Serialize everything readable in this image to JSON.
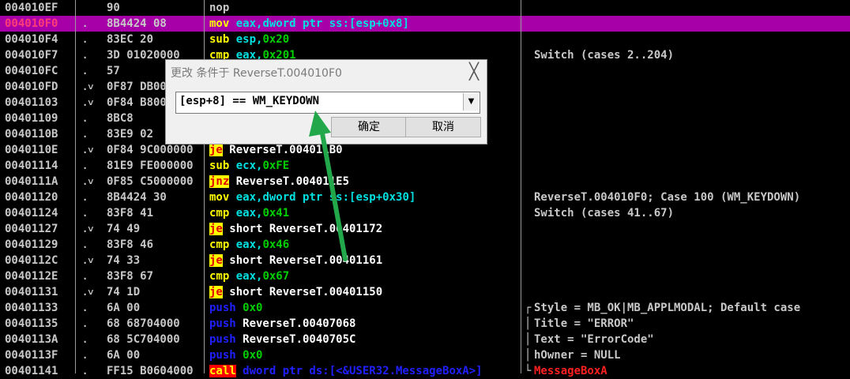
{
  "rows": [
    {
      "addr": "004010EF",
      "mark": "",
      "hex": "90",
      "selected": false,
      "asm": [
        [
          "nop",
          "t-gray"
        ]
      ],
      "cmt": ""
    },
    {
      "addr": "004010F0",
      "mark": ".",
      "hex": "8B4424 08",
      "selected": true,
      "asm": [
        [
          "mov",
          "m-yellow2"
        ],
        [
          " eax,dword ptr ss:[esp+0x8]",
          "t-cyan"
        ]
      ],
      "cmt": ""
    },
    {
      "addr": "004010F4",
      "mark": ".",
      "hex": "83EC 20",
      "selected": false,
      "asm": [
        [
          "sub",
          "m-yellow2"
        ],
        [
          " esp,",
          "t-cyan"
        ],
        [
          "0x20",
          "t-green"
        ]
      ],
      "cmt": ""
    },
    {
      "addr": "004010F7",
      "mark": ".",
      "hex": "3D 01020000",
      "selected": false,
      "asm": [
        [
          "cmp",
          "m-yellow2"
        ],
        [
          " eax,",
          "t-cyan"
        ],
        [
          "0x201",
          "t-green"
        ]
      ],
      "cmt": "Switch (cases 2..204)"
    },
    {
      "addr": "004010FC",
      "mark": ".",
      "hex": "57",
      "selected": false,
      "asm": [],
      "cmt": ""
    },
    {
      "addr": "004010FD",
      "mark": ".˅",
      "hex": "0F87 DB000000",
      "selected": false,
      "asm": [],
      "cmt": ""
    },
    {
      "addr": "00401103",
      "mark": ".˅",
      "hex": "0F84 B8000000",
      "selected": false,
      "asm": [],
      "cmt": ""
    },
    {
      "addr": "00401109",
      "mark": ".",
      "hex": "8BC8",
      "selected": false,
      "asm": [],
      "cmt": ""
    },
    {
      "addr": "0040110B",
      "mark": ".",
      "hex": "83E9 02",
      "selected": false,
      "asm": [],
      "cmt": ""
    },
    {
      "addr": "0040110E",
      "mark": ".˅",
      "hex": "0F84 9C000000",
      "selected": false,
      "asm": [
        [
          "je",
          "m-yellow"
        ],
        [
          " ReverseT.004011B0",
          "t-white"
        ]
      ],
      "cmt": ""
    },
    {
      "addr": "00401114",
      "mark": ".",
      "hex": "81E9 FE000000",
      "selected": false,
      "asm": [
        [
          "sub",
          "m-yellow2"
        ],
        [
          " ecx,",
          "t-cyan"
        ],
        [
          "0xFE",
          "t-green"
        ]
      ],
      "cmt": ""
    },
    {
      "addr": "0040111A",
      "mark": ".˅",
      "hex": "0F85 C5000000",
      "selected": false,
      "asm": [
        [
          "jnz",
          "m-yellow"
        ],
        [
          " ReverseT.004011E5",
          "t-white"
        ]
      ],
      "cmt": ""
    },
    {
      "addr": "00401120",
      "mark": ".",
      "hex": "8B4424 30",
      "selected": false,
      "asm": [
        [
          "mov",
          "m-yellow2"
        ],
        [
          " eax,dword ptr ss:[esp+0x30]",
          "t-cyan"
        ]
      ],
      "cmt": "ReverseT.004010F0; Case 100 (WM_KEYDOWN)"
    },
    {
      "addr": "00401124",
      "mark": ".",
      "hex": "83F8 41",
      "selected": false,
      "asm": [
        [
          "cmp",
          "m-yellow2"
        ],
        [
          " eax,",
          "t-cyan"
        ],
        [
          "0x41",
          "t-green"
        ]
      ],
      "cmt": "Switch (cases 41..67)"
    },
    {
      "addr": "00401127",
      "mark": ".˅",
      "hex": "74 49",
      "selected": false,
      "asm": [
        [
          "je",
          "m-yellow"
        ],
        [
          " short ReverseT.00401172",
          "t-white"
        ]
      ],
      "cmt": ""
    },
    {
      "addr": "00401129",
      "mark": ".",
      "hex": "83F8 46",
      "selected": false,
      "asm": [
        [
          "cmp",
          "m-yellow2"
        ],
        [
          " eax,",
          "t-cyan"
        ],
        [
          "0x46",
          "t-green"
        ]
      ],
      "cmt": ""
    },
    {
      "addr": "0040112C",
      "mark": ".˅",
      "hex": "74 33",
      "selected": false,
      "asm": [
        [
          "je",
          "m-yellow"
        ],
        [
          " short ReverseT.00401161",
          "t-white"
        ]
      ],
      "cmt": ""
    },
    {
      "addr": "0040112E",
      "mark": ".",
      "hex": "83F8 67",
      "selected": false,
      "asm": [
        [
          "cmp",
          "m-yellow2"
        ],
        [
          " eax,",
          "t-cyan"
        ],
        [
          "0x67",
          "t-green"
        ]
      ],
      "cmt": ""
    },
    {
      "addr": "00401131",
      "mark": ".˅",
      "hex": "74 1D",
      "selected": false,
      "asm": [
        [
          "je",
          "m-yellow"
        ],
        [
          " short ReverseT.00401150",
          "t-white"
        ]
      ],
      "cmt": ""
    },
    {
      "addr": "00401133",
      "mark": ".",
      "hex": "6A 00",
      "selected": false,
      "asm": [
        [
          "push",
          "m-blue"
        ],
        [
          " 0x0",
          "t-green"
        ]
      ],
      "cmt": "Style = MB_OK|MB_APPLMODAL; Default case",
      "brace": "┌"
    },
    {
      "addr": "00401135",
      "mark": ".",
      "hex": "68 68704000",
      "selected": false,
      "asm": [
        [
          "push",
          "m-blue"
        ],
        [
          " ReverseT.00407068",
          "t-white"
        ]
      ],
      "cmt": "Title = \"ERROR\"",
      "brace": "│"
    },
    {
      "addr": "0040113A",
      "mark": ".",
      "hex": "68 5C704000",
      "selected": false,
      "asm": [
        [
          "push",
          "m-blue"
        ],
        [
          " ReverseT.0040705C",
          "t-white"
        ]
      ],
      "cmt": "Text = \"ErrorCode\"",
      "brace": "│"
    },
    {
      "addr": "0040113F",
      "mark": ".",
      "hex": "6A 00",
      "selected": false,
      "asm": [
        [
          "push",
          "m-blue"
        ],
        [
          " 0x0",
          "t-green"
        ]
      ],
      "cmt": "hOwner = NULL",
      "brace": "│"
    },
    {
      "addr": "00401141",
      "mark": ".",
      "hex": "FF15 B0604000",
      "selected": false,
      "asm": [
        [
          "call",
          "m-red"
        ],
        [
          " dword ptr ds:[<&USER32.MessageBoxA>]",
          "t-blue"
        ]
      ],
      "cmt": "MessageBoxA",
      "cmt_red": true,
      "brace": "└"
    }
  ],
  "dialog": {
    "title": "更改 条件于 ReverseT.004010F0",
    "close": "╳",
    "condition": "[esp+8] == WM_KEYDOWN",
    "dropdown": "▼",
    "ok": "确定",
    "cancel": "取消"
  },
  "colors": {
    "selected_row": "#a800a8",
    "arrow": "#22a84a"
  }
}
